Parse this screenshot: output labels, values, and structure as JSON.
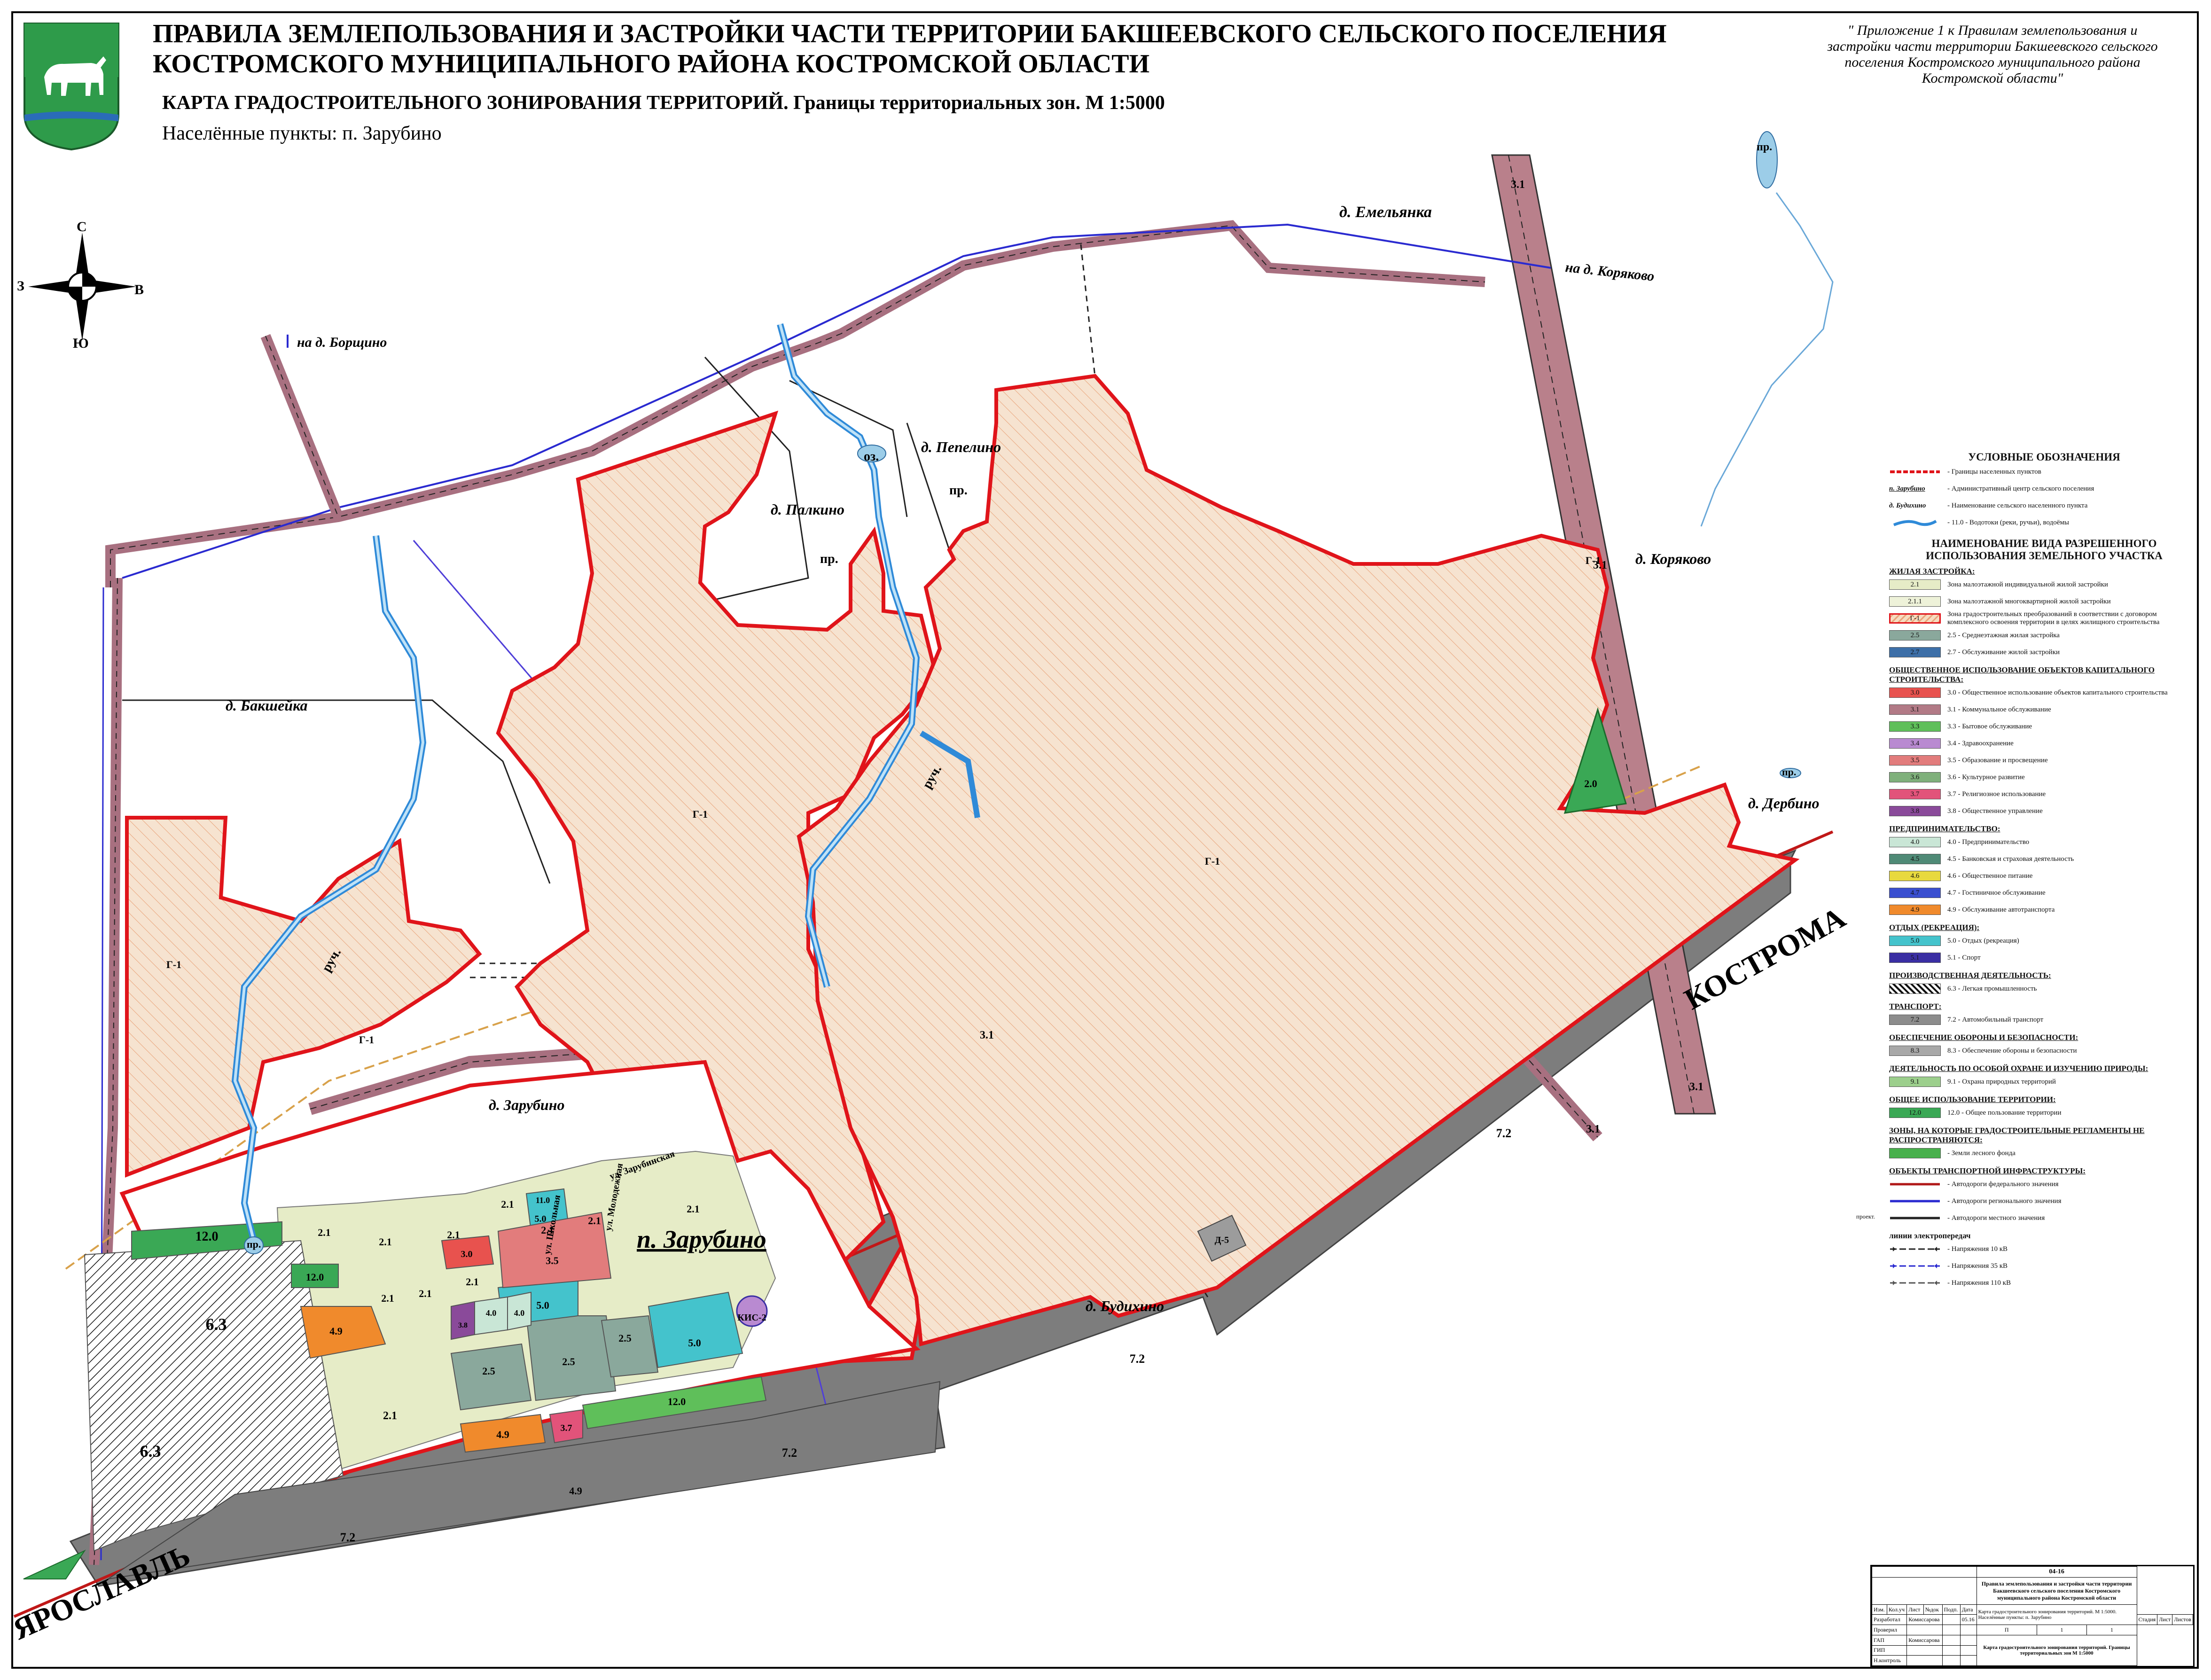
{
  "title": {
    "line1": "ПРАВИЛА ЗЕМЛЕПОЛЬЗОВАНИЯ И ЗАСТРОЙКИ ЧАСТИ ТЕРРИТОРИИ БАКШЕЕВСКОГО СЕЛЬСКОГО ПОСЕЛЕНИЯ",
    "line2": "КОСТРОМСКОГО МУНИЦИПАЛЬНОГО РАЙОНА КОСТРОМСКОЙ ОБЛАСТИ",
    "subtitle": "КАРТА ГРАДОСТРОИТЕЛЬНОГО ЗОНИРОВАНИЯ ТЕРРИТОРИЙ. Границы территориальных зон. М 1:5000",
    "settlements": "Населённые пункты: п. Зарубино",
    "appendix": "\" Приложение 1 к Правилам землепользования и застройки части территории Бакшеевского сельского поселения Костромского муниципального района Костромской области\""
  },
  "compass": {
    "north": "С",
    "south": "Ю",
    "west": "З",
    "east": "В"
  },
  "map": {
    "places": {
      "emelyanka": "д. Емельянка",
      "to_koryakovo": "на д. Коряково",
      "to_borshchino": "на д. Борщино",
      "pepelino": "д. Пепелино",
      "palkino": "д. Палкино",
      "bakshejka": "д. Бакшейка",
      "koryakovo": "д. Коряково",
      "derbino": "д. Дербино",
      "zarubino_village": "д. Зарубино",
      "zarubino_main": "п. Зарубино",
      "budikhino": "д. Будихино",
      "kostroma": "КОСТРОМА",
      "yaroslavl": "ЯРОСЛАВЛЬ"
    },
    "water": {
      "lake": "оз.",
      "pond1": "пр.",
      "pond2": "пр.",
      "pond3": "пр.",
      "pond4": "пр.",
      "pond5": "пр.",
      "stream1": "руч.",
      "stream2": "руч."
    },
    "streets": {
      "s1": "ул. Зарубинская",
      "s2": "ул. Школьная",
      "s3": "ул. Молодежная"
    },
    "zones": {
      "g1a": "Г-1",
      "g1b": "Г-1",
      "g1c": "Г-1",
      "g1d": "Г-1",
      "g1e": "Г-1",
      "z31a": "3.1",
      "z31b": "3.1",
      "z31c": "3.1",
      "z31d": "3.1",
      "z31e": "3.1",
      "z72a": "7.2",
      "z72b": "7.2",
      "z72c": "7.2",
      "z72d": "7.2",
      "z120a": "12.0",
      "z120b": "12.0",
      "z120c": "12.0",
      "z63a": "6.3",
      "z63b": "6.3",
      "z49a": "4.9",
      "z49b": "4.9",
      "z49c": "4.9",
      "z21a": "2.1",
      "z21b": "2.1",
      "z21c": "2.1",
      "z21d": "2.1",
      "z21e": "2.1",
      "z21f": "2.1",
      "z21g": "2.1",
      "z21h": "2.1",
      "z21i": "2.1",
      "z21j": "2.1",
      "z21k": "2.1",
      "z25a": "2.5",
      "z25b": "2.5",
      "z25c": "2.5",
      "z50a": "5.0",
      "z50b": "5.0",
      "z50c": "5.0",
      "z40a": "4.0",
      "z40b": "4.0",
      "z30": "3.0",
      "z35": "3.5",
      "z37": "3.7",
      "z38": "3.8",
      "z110": "11.0",
      "z20": "2.0",
      "zd5": "Д-5",
      "zkis": "КИС-2"
    }
  },
  "legend": {
    "heading": "УСЛОВНЫЕ ОБОЗНАЧЕНИЯ",
    "general": [
      {
        "swatch_text": "",
        "label": "- Границы населенных пунктов",
        "kind": "redline"
      },
      {
        "swatch_text": "п. Зарубино",
        "label": "- Административный центр сельского поселения",
        "kind": "text"
      },
      {
        "swatch_text": "д. Будихино",
        "label": "- Наименование сельского населенного пункта",
        "kind": "text"
      },
      {
        "swatch_text": "",
        "label": "- 11.0 - Водотоки (реки, ручьи), водоёмы",
        "kind": "water"
      }
    ],
    "subheading": "НАИМЕНОВАНИЕ ВИДА РАЗРЕШЕННОГО ИСПОЛЬЗОВАНИЯ ЗЕМЕЛЬНОГО УЧАСТКА",
    "sections": [
      {
        "title": "ЖИЛАЯ ЗАСТРОЙКА:",
        "items": [
          {
            "code": "2.1",
            "color": "#e6ecc7",
            "label": "Зона малоэтажной индивидуальной жилой застройки"
          },
          {
            "code": "2.1.1",
            "color": "#eef2d9",
            "label": "Зона малоэтажной многоквартирной жилой застройки"
          },
          {
            "code": "Г-1",
            "color": "#f6dcc0",
            "label": "Зона градостроительных преобразований в соответствии с договором комплексного освоения территории в целях жилищного строительства"
          },
          {
            "code": "2.5",
            "color": "#8aa89c",
            "label": "2.5 - Среднеэтажная жилая застройка"
          },
          {
            "code": "2.7",
            "color": "#3d6fa8",
            "label": "2.7 - Обслуживание жилой застройки"
          }
        ]
      },
      {
        "title": "ОБЩЕСТВЕННОЕ ИСПОЛЬЗОВАНИЕ ОБЪЕКТОВ КАПИТАЛЬНОГО СТРОИТЕЛЬСТВА:",
        "items": [
          {
            "code": "3.0",
            "color": "#e8524e",
            "label": "3.0 - Общественное использование объектов капитального строительства"
          },
          {
            "code": "3.1",
            "color": "#b27a86",
            "label": "3.1 - Коммунальное обслуживание"
          },
          {
            "code": "3.3",
            "color": "#5fbf5a",
            "label": "3.3 - Бытовое обслуживание"
          },
          {
            "code": "3.4",
            "color": "#b98ad1",
            "label": "3.4 - Здравоохранение"
          },
          {
            "code": "3.5",
            "color": "#e27c7c",
            "label": "3.5 - Образование и просвещение"
          },
          {
            "code": "3.6",
            "color": "#7fb07b",
            "label": "3.6 - Культурное развитие"
          },
          {
            "code": "3.7",
            "color": "#e2537a",
            "label": "3.7 - Религиозное использование"
          },
          {
            "code": "3.8",
            "color": "#8a4a9a",
            "label": "3.8 - Общественное управление"
          }
        ]
      },
      {
        "title": "ПРЕДПРИНИМАТЕЛЬСТВО:",
        "items": [
          {
            "code": "4.0",
            "color": "#c9e6d6",
            "label": "4.0 - Предпринимательство"
          },
          {
            "code": "4.5",
            "color": "#4f8a76",
            "label": "4.5 - Банковская и страховая деятельность"
          },
          {
            "code": "4.6",
            "color": "#e8d93e",
            "label": "4.6 - Общественное питание"
          },
          {
            "code": "4.7",
            "color": "#3a4fd0",
            "label": "4.7 - Гостиничное обслуживание"
          },
          {
            "code": "4.9",
            "color": "#f08a2c",
            "label": "4.9 - Обслуживание автотранспорта"
          }
        ]
      },
      {
        "title": "ОТДЫХ (РЕКРЕАЦИЯ):",
        "items": [
          {
            "code": "5.0",
            "color": "#44c3cc",
            "label": "5.0 - Отдых (рекреация)"
          },
          {
            "code": "5.1",
            "color": "#3a2ea3",
            "label": "5.1 - Спорт"
          }
        ]
      },
      {
        "title": "ПРОИЗВОДСТВЕННАЯ ДЕЯТЕЛЬНОСТЬ:",
        "items": [
          {
            "code": "",
            "color": "hatch",
            "label": "6.3 - Легкая промышленность"
          }
        ]
      },
      {
        "title": "ТРАНСПОРТ:",
        "items": [
          {
            "code": "7.2",
            "color": "#8c8c8c",
            "label": "7.2 - Автомобильный транспорт"
          }
        ]
      },
      {
        "title": "ОБЕСПЕЧЕНИЕ ОБОРОНЫ И БЕЗОПАСНОСТИ:",
        "items": [
          {
            "code": "8.3",
            "color": "#a8a8a8",
            "label": "8.3 - Обеспечение обороны и безопасности"
          }
        ]
      },
      {
        "title": "ДЕЯТЕЛЬНОСТЬ ПО ОСОБОЙ ОХРАНЕ И ИЗУЧЕНИЮ ПРИРОДЫ:",
        "items": [
          {
            "code": "9.1",
            "color": "#9ccf8c",
            "label": "9.1 - Охрана природных территорий"
          }
        ]
      },
      {
        "title": "ОБЩЕЕ ИСПОЛЬЗОВАНИЕ ТЕРРИТОРИИ:",
        "items": [
          {
            "code": "12.0",
            "color": "#3aa855",
            "label": "12.0 - Общее пользование территории"
          }
        ]
      },
      {
        "title": "ЗОНЫ, НА КОТОРЫЕ ГРАДОСТРОИТЕЛЬНЫЕ РЕГЛАМЕНТЫ НЕ РАСПРОСТРАНЯЮТСЯ:",
        "items": [
          {
            "code": "",
            "color": "#48b04c",
            "label": "- Земли лесного фонда"
          }
        ]
      }
    ],
    "transport_title": "ОБЪЕКТЫ ТРАНСПОРТНОЙ ИНФРАСТРУКТУРЫ:",
    "transport": [
      {
        "label": "- Автодороги федерального значения",
        "color": "#b01818",
        "style": "solid",
        "prefix": ""
      },
      {
        "label": "- Автодороги регионального значения",
        "color": "#2a2ad0",
        "style": "solid",
        "prefix": ""
      },
      {
        "label": "- Автодороги местного значения",
        "color": "#222222",
        "style": "solid",
        "prefix": "проект."
      }
    ],
    "power_title": "линии электропередач",
    "power": [
      {
        "label": "- Напряжения 10 кВ",
        "color": "#222222"
      },
      {
        "label": "- Напряжения 35 кВ",
        "color": "#2a2ad0"
      },
      {
        "label": "- Напряжения 110 кВ",
        "color": "#555555"
      }
    ]
  },
  "stamp": {
    "code": "04-16",
    "project": "Правила землепользования и застройки части территории Бакшеевского сельского поселения Костромского муниципального района Костромской области",
    "sheet_desc": "Карта градостроительного зонирования территорий. М 1:5000. Населённые пункты: п. Зарубино",
    "stage_h": "Стадия",
    "sheet_h": "Лист",
    "sheets_h": "Листов",
    "stage": "П",
    "sheet": "1",
    "sheets": "1",
    "map_name": "Карта градостроительного зонирования территорий. Границы территориальных зон М 1:5000",
    "cols": [
      "Изм.",
      "Кол.уч",
      "Лист",
      "№док",
      "Подп.",
      "Дата"
    ],
    "rows": [
      {
        "role": "Разработал",
        "name": "Комиссарова",
        "date": "05.16"
      },
      {
        "role": "Проверил",
        "name": "",
        "date": ""
      },
      {
        "role": "ГАП",
        "name": "Комиссарова",
        "date": ""
      },
      {
        "role": "ГИП",
        "name": "",
        "date": ""
      },
      {
        "role": "Н.контроль",
        "name": "",
        "date": ""
      }
    ]
  },
  "colors": {
    "boundary": "#e0141a",
    "g1_fill": "#f6dcc0",
    "g1_hatch": "#e9a47b",
    "road_local": "#a87080",
    "road_federal": "#7a7a7a",
    "water": "#5aa8d8",
    "river": "#2f8ad8",
    "power35": "#4f3fd8",
    "power110": "#d8a14a"
  }
}
